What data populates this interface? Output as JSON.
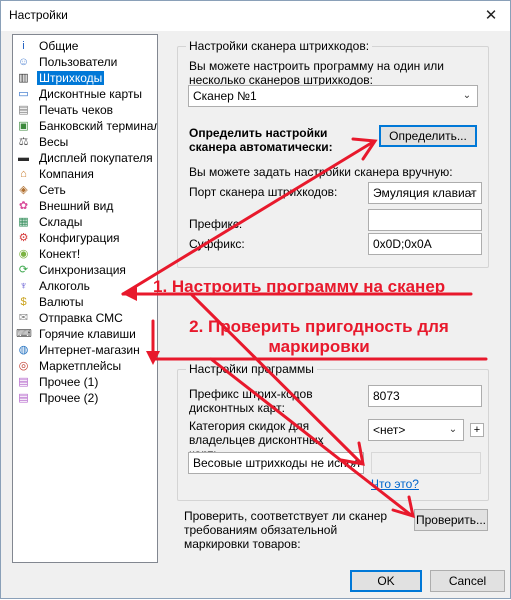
{
  "window": {
    "title": "Настройки"
  },
  "sidebar": {
    "items": [
      {
        "label": "Общие",
        "icon": "info-icon",
        "color": "#1e5fbf"
      },
      {
        "label": "Пользователи",
        "icon": "users-icon",
        "color": "#4a7fd0"
      },
      {
        "label": "Штрихкоды",
        "icon": "barcode-icon",
        "color": "#333333"
      },
      {
        "label": "Дисконтные карты",
        "icon": "discount-card-icon",
        "color": "#2f6fc9"
      },
      {
        "label": "Печать чеков",
        "icon": "receipt-print-icon",
        "color": "#777777"
      },
      {
        "label": "Банковский терминал",
        "icon": "bank-terminal-icon",
        "color": "#3c8a3c"
      },
      {
        "label": "Весы",
        "icon": "scales-icon",
        "color": "#555555"
      },
      {
        "label": "Дисплей покупателя",
        "icon": "customer-display-icon",
        "color": "#2b2b2b"
      },
      {
        "label": "Компания",
        "icon": "company-icon",
        "color": "#c77b2a"
      },
      {
        "label": "Сеть",
        "icon": "network-icon",
        "color": "#b07030"
      },
      {
        "label": "Внешний вид",
        "icon": "appearance-icon",
        "color": "#d94c9a"
      },
      {
        "label": "Склады",
        "icon": "warehouse-icon",
        "color": "#2e8b57"
      },
      {
        "label": "Конфигурация",
        "icon": "configuration-icon",
        "color": "#d63b3b"
      },
      {
        "label": "Конект!",
        "icon": "android-icon",
        "color": "#7cb342"
      },
      {
        "label": "Синхронизация",
        "icon": "sync-icon",
        "color": "#3aa64a"
      },
      {
        "label": "Алкоголь",
        "icon": "alcohol-icon",
        "color": "#5a4fcf"
      },
      {
        "label": "Валюты",
        "icon": "currency-icon",
        "color": "#caa21b"
      },
      {
        "label": "Отправка СМС",
        "icon": "sms-icon",
        "color": "#888888"
      },
      {
        "label": "Горячие клавиши",
        "icon": "hotkeys-icon",
        "color": "#555555"
      },
      {
        "label": "Интернет-магазин",
        "icon": "online-store-icon",
        "color": "#1f6fbf"
      },
      {
        "label": "Маркетплейсы",
        "icon": "marketplace-icon",
        "color": "#c0392b"
      },
      {
        "label": "Прочее (1)",
        "icon": "misc-icon",
        "color": "#b05ec8"
      },
      {
        "label": "Прочее (2)",
        "icon": "misc-icon",
        "color": "#b05ec8"
      }
    ],
    "selected_index": 2
  },
  "scanner_group": {
    "title": "Настройки сканера штрихкодов:",
    "intro": "Вы можете настроить программу на один или несколько сканеров штрихкодов:",
    "scanner_select": "Сканер №1",
    "auto_label": "Определить настройки сканера автоматически:",
    "detect_button": "Определить...",
    "manual_label": "Вы можете задать настройки сканера вручную:",
    "port_label": "Порт сканера штрихкодов:",
    "port_value": "Эмуляция клавиат",
    "prefix_label": "Префикс:",
    "prefix_value": "",
    "suffix_label": "Суффикс:",
    "suffix_value": "0x0D;0x0A"
  },
  "program_group": {
    "title": "Настройки программы",
    "card_prefix_label": "Префикс штрих-кодов дисконтных карт:",
    "card_prefix_value": "8073",
    "category_label": "Категория скидок для владельцев дисконтных карт:",
    "category_value": "<нет>",
    "weight_select": "Весовые штрихкоды не испол",
    "help_link": "Что это?"
  },
  "check": {
    "label": "Проверить, соответствует ли сканер требованиям обязательной маркировки товаров:",
    "button": "Проверить..."
  },
  "footer": {
    "ok": "OK",
    "cancel": "Cancel"
  },
  "annotations": {
    "step1": "1. Настроить программу на сканер",
    "step2": "2. Проверить пригодность для маркировки",
    "color": "#e8192c"
  }
}
